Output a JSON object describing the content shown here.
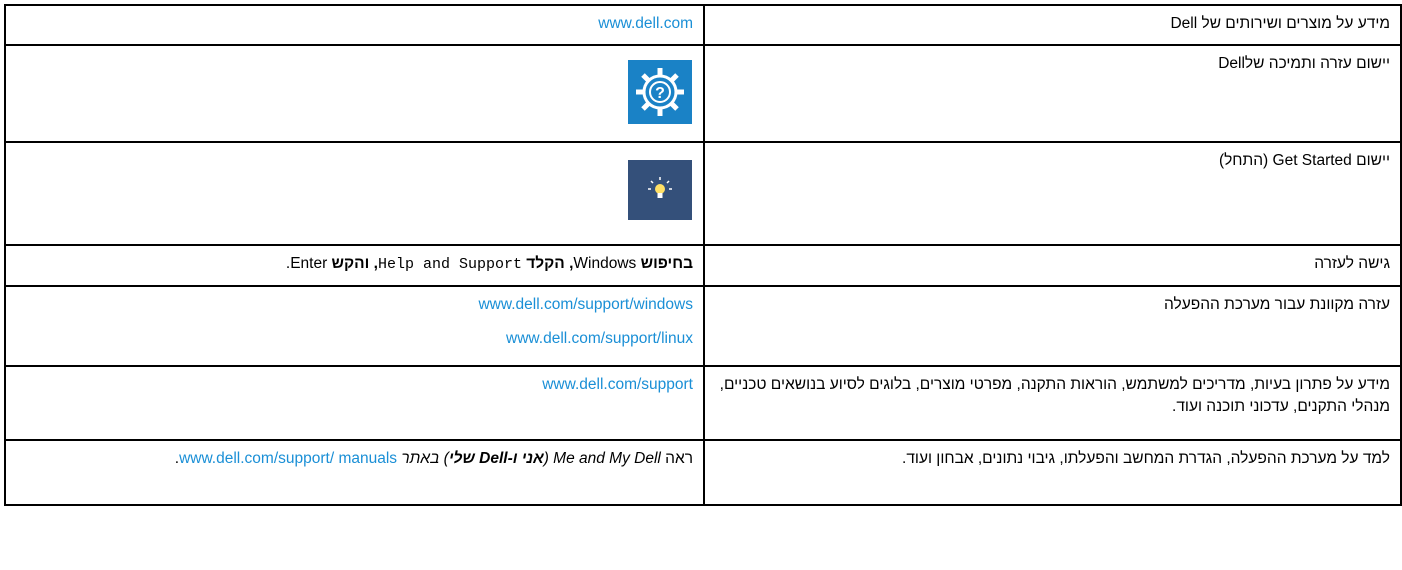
{
  "rows": [
    {
      "label": "מידע על מוצרים ושירותים של Dell",
      "content_link": "www.dell.com"
    },
    {
      "label": "יישום עזרה ותמיכה שלDell",
      "icon": "help-gear-icon",
      "icon_color": "#1a82c6"
    },
    {
      "label": "יישום Get Started (התחל)",
      "icon": "lightbulb-icon",
      "icon_color": "#34507a"
    },
    {
      "label": "גישה לעזרה",
      "content": {
        "part1": "בחיפוש ",
        "part2": "Windows",
        "part3": ", הקלד ",
        "part4": "Help and Support",
        "part5": ", והקש ",
        "part6": "Enter",
        "part7": "."
      }
    },
    {
      "label": "עזרה מקוונת עבור מערכת ההפעלה",
      "links": [
        "www.dell.com/support/windows",
        "www.dell.com/support/linux"
      ]
    },
    {
      "label": "מידע על פתרון בעיות, מדריכים למשתמש, הוראות התקנה, מפרטי מוצרים, בלוגים לסיוע בנושאים טכניים, מנהלי התקנים, עדכוני תוכנה ועוד.",
      "content_link": "www.dell.com/support"
    },
    {
      "label": "למד על מערכת ההפעלה, הגדרת המחשב והפעלתו, גיבוי נתונים, אבחון ועוד.",
      "content": {
        "part1": "ראה ",
        "part2": "Me and My Dell",
        "part3": " (",
        "part4": "אני ו-Dell שלי",
        "part5": ") באתר ",
        "link": "www.dell.com/support/ manuals",
        "end": "."
      }
    }
  ],
  "colors": {
    "link": "#1a8fd6",
    "border": "#000000"
  }
}
